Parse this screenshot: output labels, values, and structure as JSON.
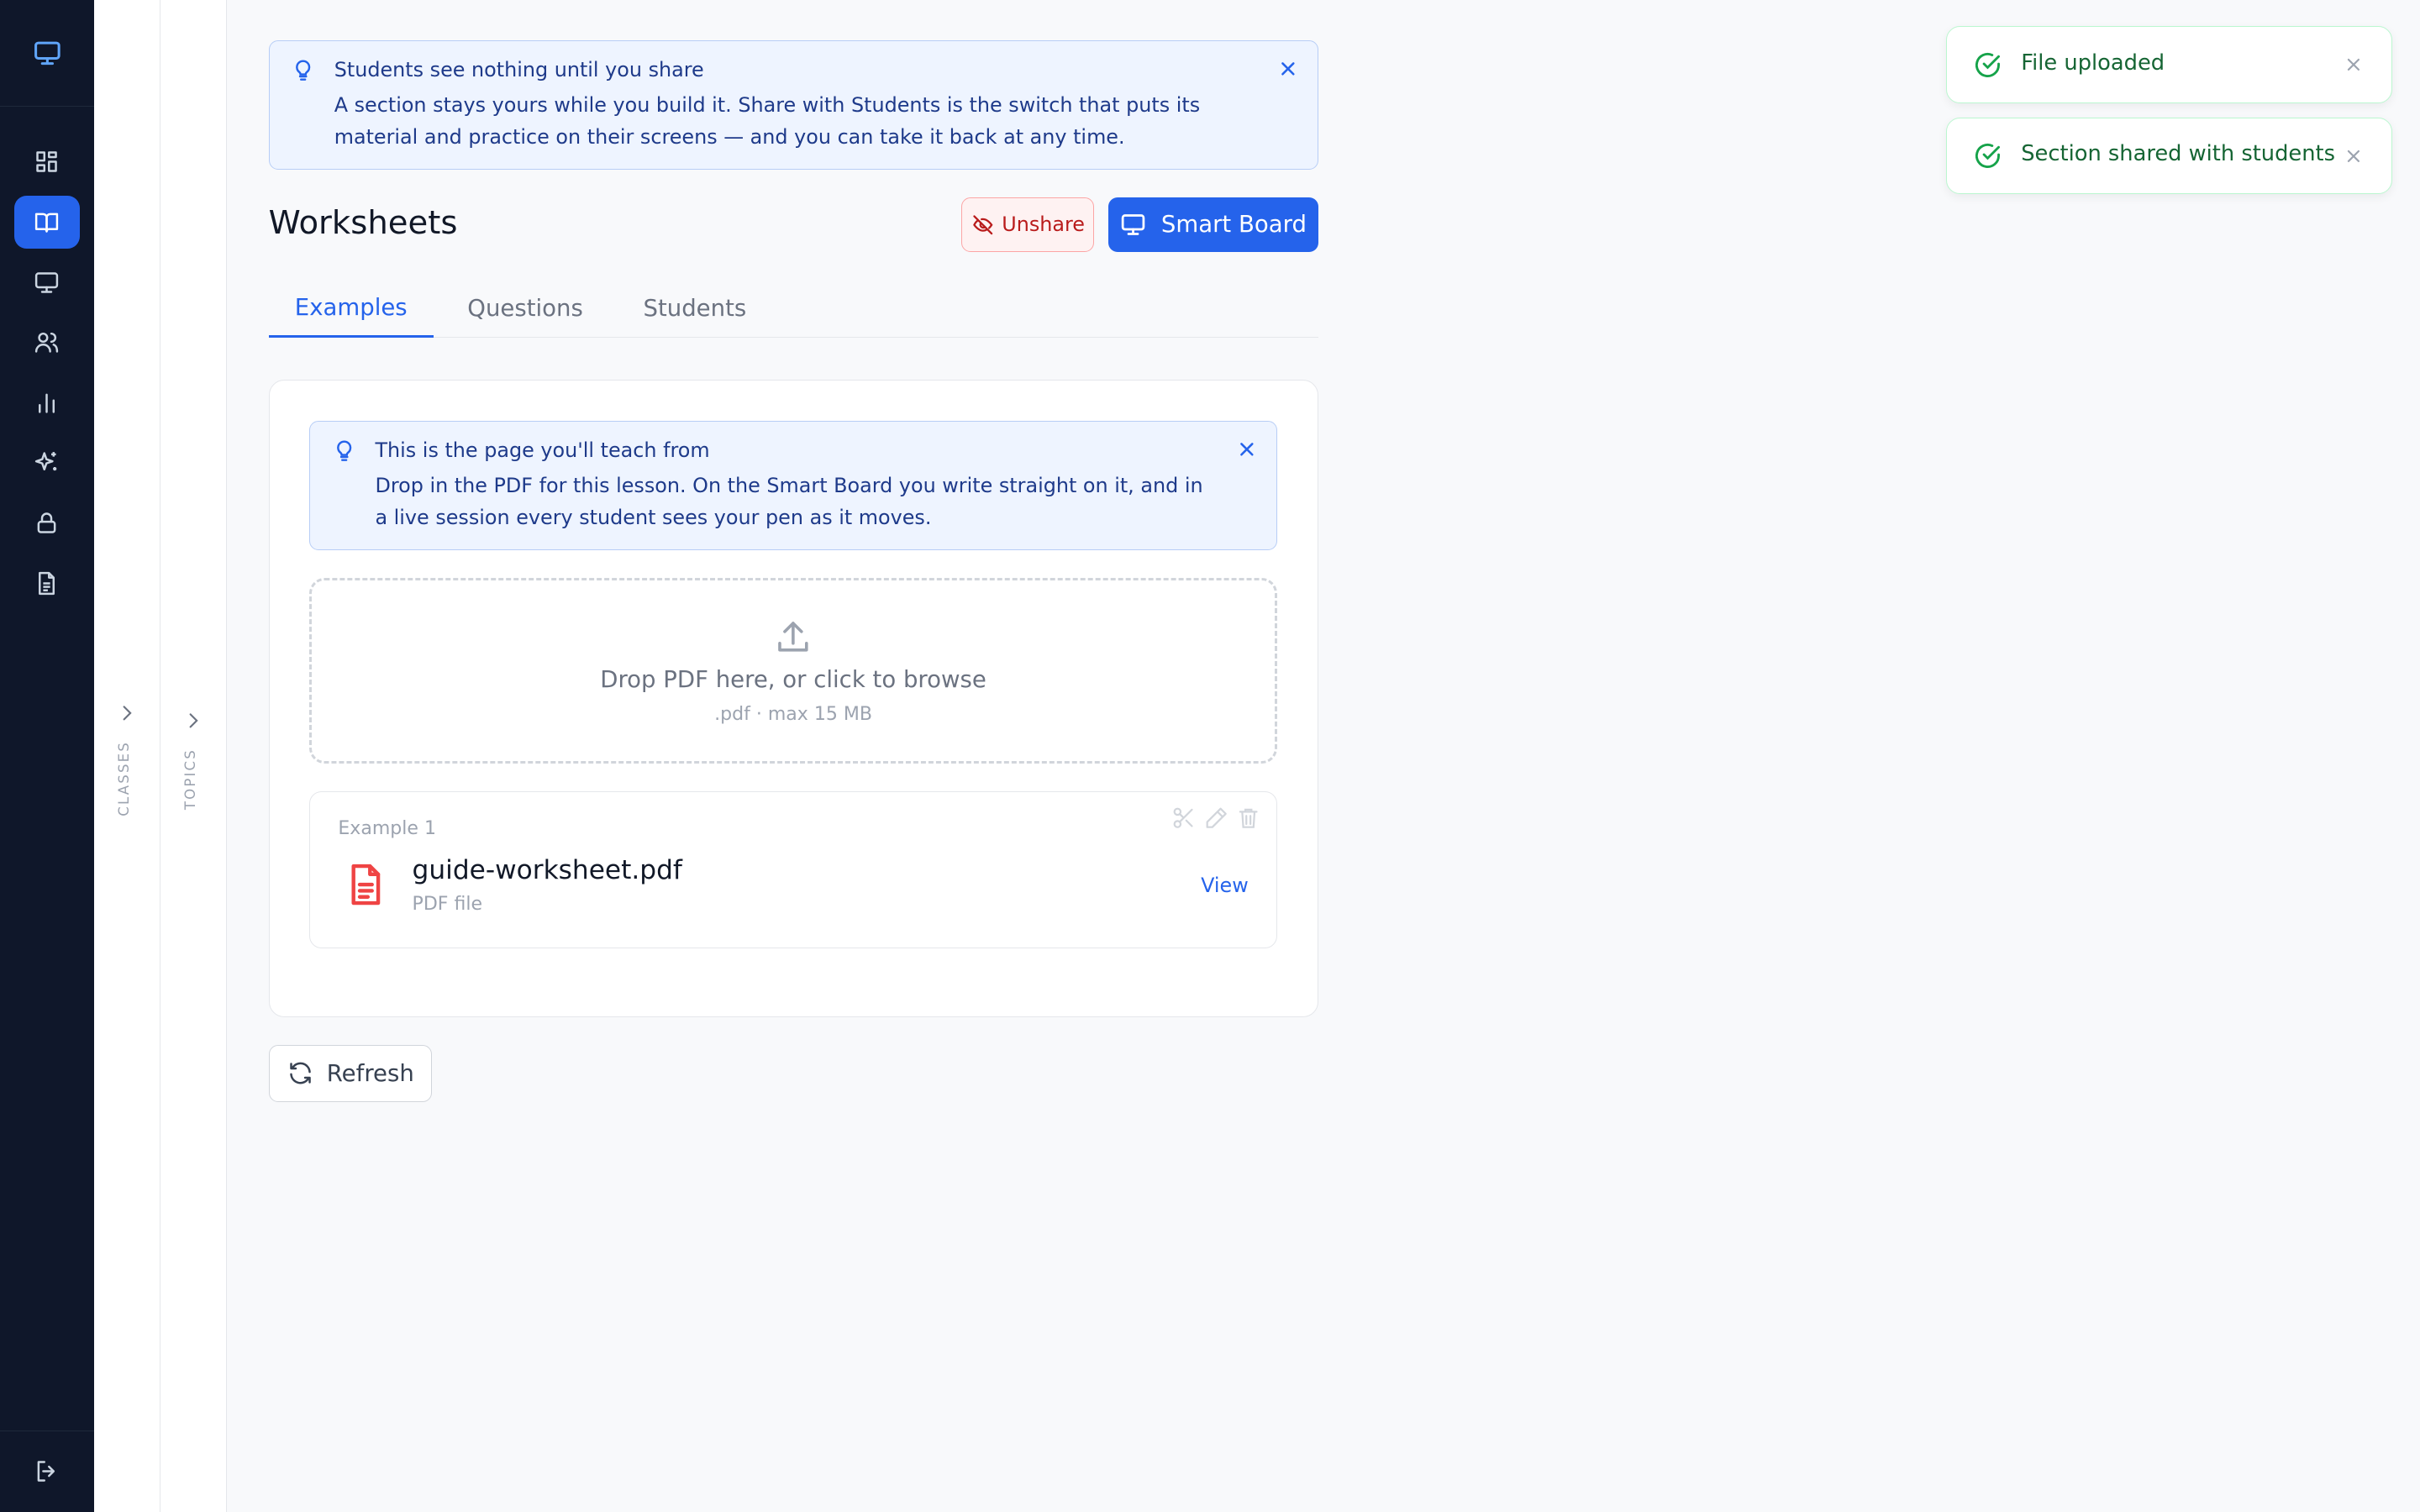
{
  "colors": {
    "rail_bg": "#0f172a",
    "accent": "#2563eb",
    "danger": "#b91c1c",
    "success": "#16a34a"
  },
  "rail": {
    "logo_icon": "monitor-icon",
    "items": [
      {
        "icon": "dashboard-icon",
        "active": false
      },
      {
        "icon": "book-open-icon",
        "active": true
      },
      {
        "icon": "monitor-icon",
        "active": false
      },
      {
        "icon": "users-icon",
        "active": false
      },
      {
        "icon": "bar-chart-icon",
        "active": false
      },
      {
        "icon": "sparkles-icon",
        "active": false
      },
      {
        "icon": "lock-icon",
        "active": false
      },
      {
        "icon": "document-icon",
        "active": false
      }
    ],
    "logout_icon": "logout-icon"
  },
  "panels": {
    "classes_label": "CLASSES",
    "topics_label": "TOPICS"
  },
  "share_tip": {
    "title": "Students see nothing until you share",
    "body": "A section stays yours while you build it. Share with Students is the switch that puts its material and practice on their screens — and you can take it back at any time."
  },
  "header": {
    "title": "Worksheets",
    "unshare_label": "Unshare",
    "smartboard_label": "Smart Board"
  },
  "tabs": [
    {
      "label": "Examples",
      "active": true
    },
    {
      "label": "Questions",
      "active": false
    },
    {
      "label": "Students",
      "active": false
    }
  ],
  "teach_tip": {
    "title": "This is the page you'll teach from",
    "body": "Drop in the PDF for this lesson. On the Smart Board you write straight on it, and in a live session every student sees your pen as it moves."
  },
  "dropzone": {
    "label": "Drop PDF here, or click to browse",
    "hint": ".pdf · max 15 MB"
  },
  "file": {
    "example_label": "Example 1",
    "name": "guide-worksheet.pdf",
    "type": "PDF file",
    "view_label": "View"
  },
  "refresh_label": "Refresh",
  "toasts": [
    {
      "message": "File uploaded"
    },
    {
      "message": "Section shared with students"
    }
  ]
}
